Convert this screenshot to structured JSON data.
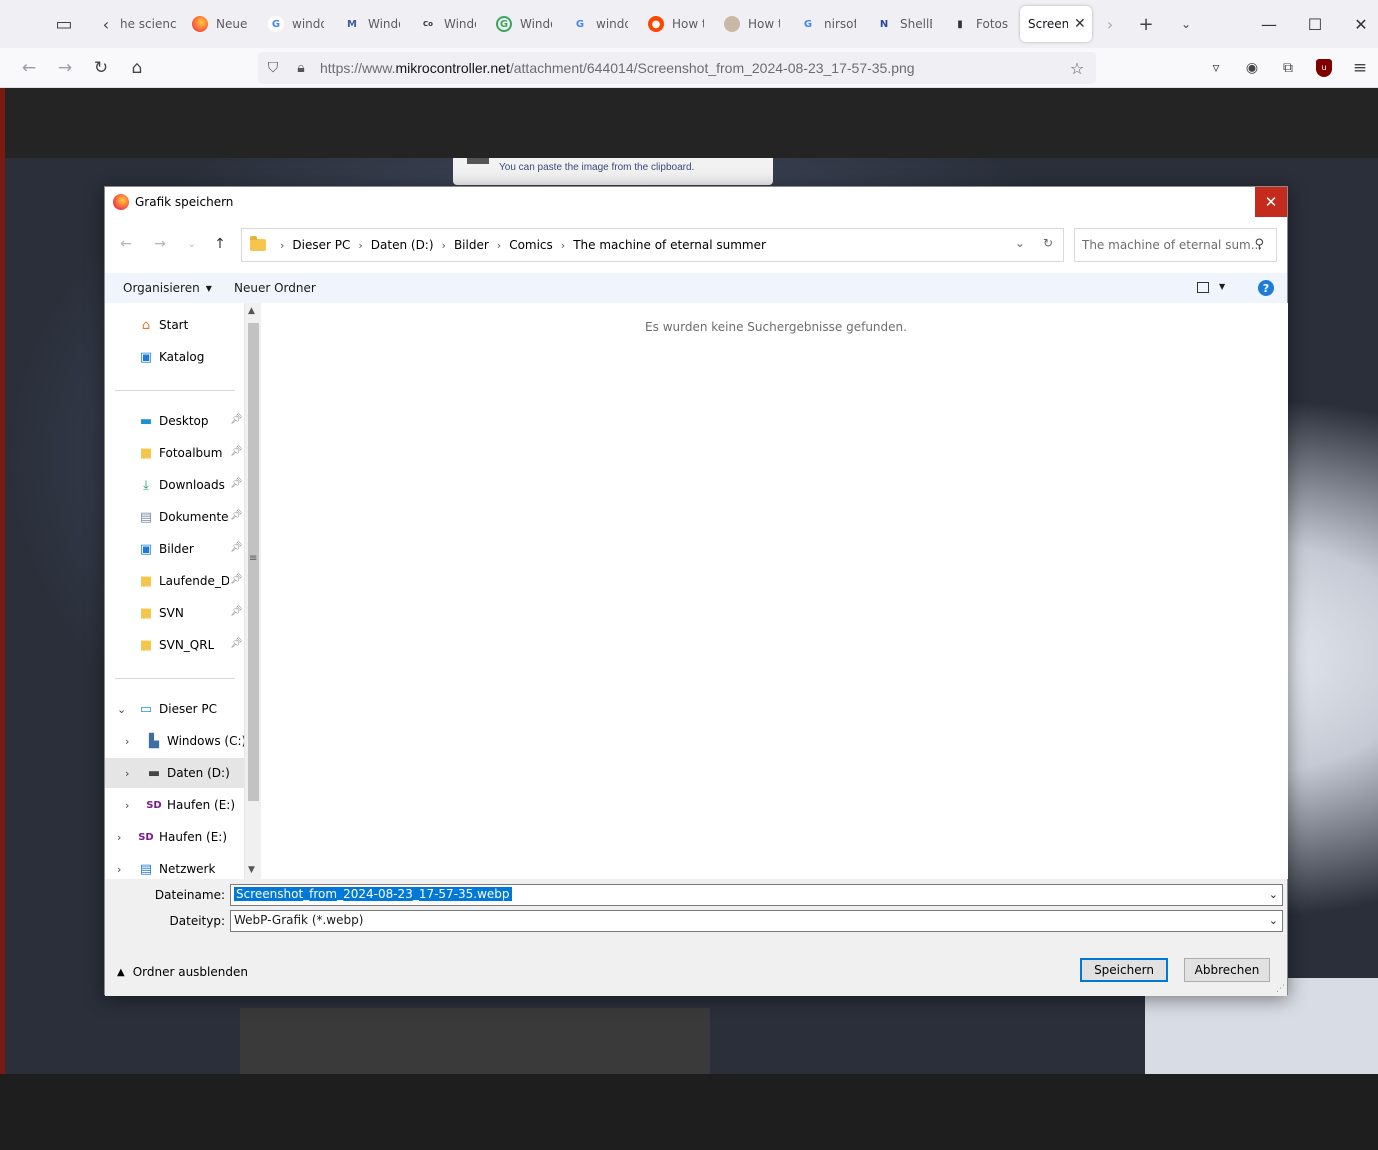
{
  "browser": {
    "tabs": [
      {
        "label": "he scienc",
        "icon": "site-icon"
      },
      {
        "label": "Neuer",
        "icon": "firefox-icon"
      },
      {
        "label": "windo",
        "icon": "google-icon"
      },
      {
        "label": "Windo",
        "icon": "site-icon"
      },
      {
        "label": "Windo",
        "icon": "site-icon"
      },
      {
        "label": "Windo",
        "icon": "site-icon"
      },
      {
        "label": "windo",
        "icon": "google-icon"
      },
      {
        "label": "How t",
        "icon": "reddit-icon"
      },
      {
        "label": "How t",
        "icon": "site-icon"
      },
      {
        "label": "nirsof",
        "icon": "google-icon"
      },
      {
        "label": "ShellE",
        "icon": "site-icon"
      },
      {
        "label": "Fotos",
        "icon": "site-icon"
      },
      {
        "label": "Screens",
        "icon": "page-icon"
      }
    ],
    "url_prefix": "https://www.",
    "url_host": "mikrocontroller.net",
    "url_path": "/attachment/644014/Screenshot_from_2024-08-23_17-57-35.png",
    "tooltip": "You can paste the image from the clipboard."
  },
  "dialog": {
    "title": "Grafik speichern",
    "close_glyph": "✕",
    "breadcrumb": [
      "Dieser PC",
      "Daten (D:)",
      "Bilder",
      "Comics",
      "The machine of eternal summer"
    ],
    "search_placeholder": "The machine of eternal sum...",
    "toolbar": {
      "organize": "Organisieren",
      "new_folder": "Neuer Ordner",
      "help": "?"
    },
    "nav": {
      "quick": [
        {
          "label": "Start",
          "icon": "home-icon"
        },
        {
          "label": "Katalog",
          "icon": "gallery-icon"
        }
      ],
      "pinned": [
        {
          "label": "Desktop",
          "icon": "desktop-icon"
        },
        {
          "label": "Fotoalbum",
          "icon": "folder-icon"
        },
        {
          "label": "Downloads",
          "icon": "download-icon"
        },
        {
          "label": "Dokumente",
          "icon": "documents-icon"
        },
        {
          "label": "Bilder",
          "icon": "pictures-icon"
        },
        {
          "label": "Laufende_Da",
          "icon": "folder-icon"
        },
        {
          "label": "SVN",
          "icon": "folder-icon"
        },
        {
          "label": "SVN_QRL",
          "icon": "folder-icon"
        }
      ],
      "tree": [
        {
          "label": "Dieser PC",
          "icon": "computer-icon",
          "expanded": true
        },
        {
          "label": "Windows (C:)",
          "icon": "drive-icon"
        },
        {
          "label": "Daten (D:)",
          "icon": "drive-icon",
          "selected": true
        },
        {
          "label": "Haufen (E:)",
          "icon": "sd-card-icon"
        },
        {
          "label": "Haufen (E:)",
          "icon": "sd-card-icon"
        },
        {
          "label": "Netzwerk",
          "icon": "network-icon"
        }
      ]
    },
    "empty_message": "Es wurden keine Suchergebnisse gefunden.",
    "filename_label": "Dateiname:",
    "filename_value": "Screenshot_from_2024-08-23_17-57-35.webp",
    "filetype_label": "Dateityp:",
    "filetype_value": "WebP-Grafik (*.webp)",
    "hide_folders": "Ordner ausblenden",
    "save_button": "Speichern",
    "cancel_button": "Abbrechen"
  },
  "colors": {
    "accent": "#0078d7",
    "close_red": "#c42b1c",
    "command_bar": "#f0f4fc"
  }
}
